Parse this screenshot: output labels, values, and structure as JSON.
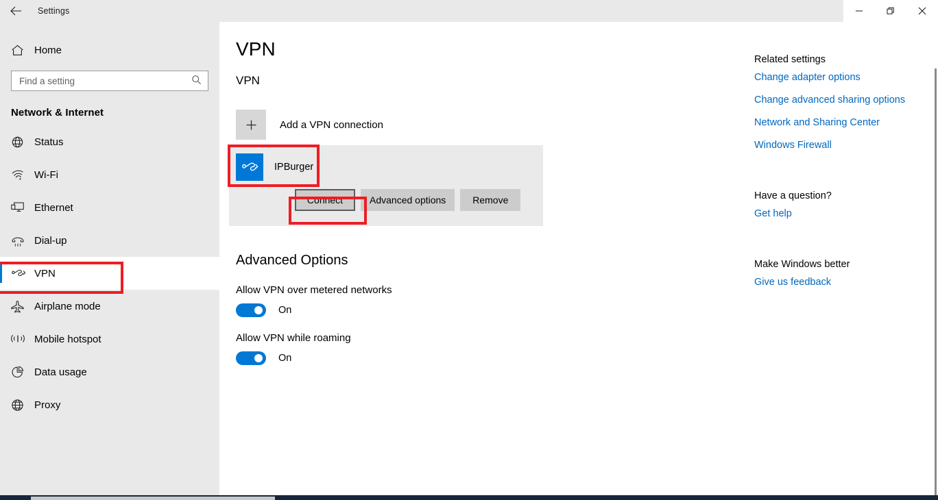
{
  "window": {
    "title": "Settings",
    "back_icon": "back-arrow-icon",
    "controls": {
      "minimize": "minimize-icon",
      "restore": "restore-icon",
      "close": "close-icon"
    }
  },
  "sidebar": {
    "home": {
      "label": "Home",
      "icon": "home-icon"
    },
    "search": {
      "placeholder": "Find a setting",
      "value": "",
      "icon": "search-icon"
    },
    "category": "Network & Internet",
    "items": [
      {
        "label": "Status",
        "icon": "globe-status-icon",
        "selected": false
      },
      {
        "label": "Wi-Fi",
        "icon": "wifi-icon",
        "selected": false
      },
      {
        "label": "Ethernet",
        "icon": "ethernet-icon",
        "selected": false
      },
      {
        "label": "Dial-up",
        "icon": "dialup-phone-icon",
        "selected": false
      },
      {
        "label": "VPN",
        "icon": "vpn-icon",
        "selected": true
      },
      {
        "label": "Airplane mode",
        "icon": "airplane-icon",
        "selected": false
      },
      {
        "label": "Mobile hotspot",
        "icon": "hotspot-icon",
        "selected": false
      },
      {
        "label": "Data usage",
        "icon": "pie-chart-icon",
        "selected": false
      },
      {
        "label": "Proxy",
        "icon": "globe-icon",
        "selected": false
      }
    ]
  },
  "main": {
    "page_title": "VPN",
    "section_title": "VPN",
    "add_connection": {
      "label": "Add a VPN connection",
      "icon": "plus-icon"
    },
    "connection": {
      "name": "IPBurger",
      "icon": "vpn-tile-icon",
      "icon_bg": "#0078d7",
      "buttons": [
        {
          "label": "Connect",
          "focused": true
        },
        {
          "label": "Advanced options",
          "focused": false
        },
        {
          "label": "Remove",
          "focused": false
        }
      ]
    },
    "advanced": {
      "title": "Advanced Options",
      "options": [
        {
          "label": "Allow VPN over metered networks",
          "state": "On",
          "on": true
        },
        {
          "label": "Allow VPN while roaming",
          "state": "On",
          "on": true
        }
      ]
    }
  },
  "right_panel": {
    "related_heading": "Related settings",
    "related_links": [
      "Change adapter options",
      "Change advanced sharing options",
      "Network and Sharing Center",
      "Windows Firewall"
    ],
    "question_heading": "Have a question?",
    "question_link": "Get help",
    "feedback_heading": "Make Windows better",
    "feedback_link": "Give us feedback"
  },
  "colors": {
    "accent": "#0078d4",
    "link": "#0067c0",
    "sidebar_bg": "#e9e9e9",
    "card_bg": "#eaeaea",
    "button_bg": "#cccccc",
    "annotation": "#ee1c25",
    "taskbar": "#17263a"
  }
}
